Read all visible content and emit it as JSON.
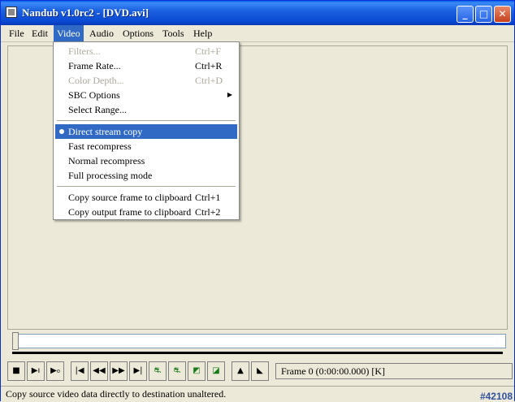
{
  "window": {
    "title": "Nandub v1.0rc2 - [DVD.avi]"
  },
  "menubar": {
    "items": [
      {
        "label": "File"
      },
      {
        "label": "Edit"
      },
      {
        "label": "Video"
      },
      {
        "label": "Audio"
      },
      {
        "label": "Options"
      },
      {
        "label": "Tools"
      },
      {
        "label": "Help"
      }
    ]
  },
  "video_menu": {
    "items": [
      {
        "label": "Filters...",
        "shortcut": "Ctrl+F",
        "disabled": true
      },
      {
        "label": "Frame Rate...",
        "shortcut": "Ctrl+R"
      },
      {
        "label": "Color Depth...",
        "shortcut": "Ctrl+D",
        "disabled": true
      },
      {
        "label": "SBC Options",
        "submenu": true
      },
      {
        "label": "Select Range..."
      },
      {
        "label": "Direct stream copy",
        "checked": true,
        "highlighted": true
      },
      {
        "label": "Fast recompress"
      },
      {
        "label": "Normal recompress"
      },
      {
        "label": "Full processing mode"
      },
      {
        "label": "Copy source frame to clipboard",
        "shortcut": "Ctrl+1"
      },
      {
        "label": "Copy output frame to clipboard",
        "shortcut": "Ctrl+2"
      }
    ]
  },
  "frame_info": "Frame 0 (0:00:00.000) [K]",
  "status": {
    "text": "Copy source video data directly to destination unaltered.",
    "tag": "#42108"
  },
  "toolbar": {
    "icons": [
      "stop-icon",
      "play-input-icon",
      "play-output-icon",
      "start-icon",
      "prev-key-icon",
      "next-key-icon",
      "end-icon",
      "mark-in-icon",
      "mark-out-icon",
      "scene-back-icon",
      "scene-forward-icon",
      "mark-in-arrow-icon",
      "mark-out-arrow-icon"
    ]
  },
  "colors": {
    "title_start": "#0a5fe8",
    "title_end": "#0838b5",
    "highlight": "#316ac5",
    "face": "#ece9d8"
  }
}
